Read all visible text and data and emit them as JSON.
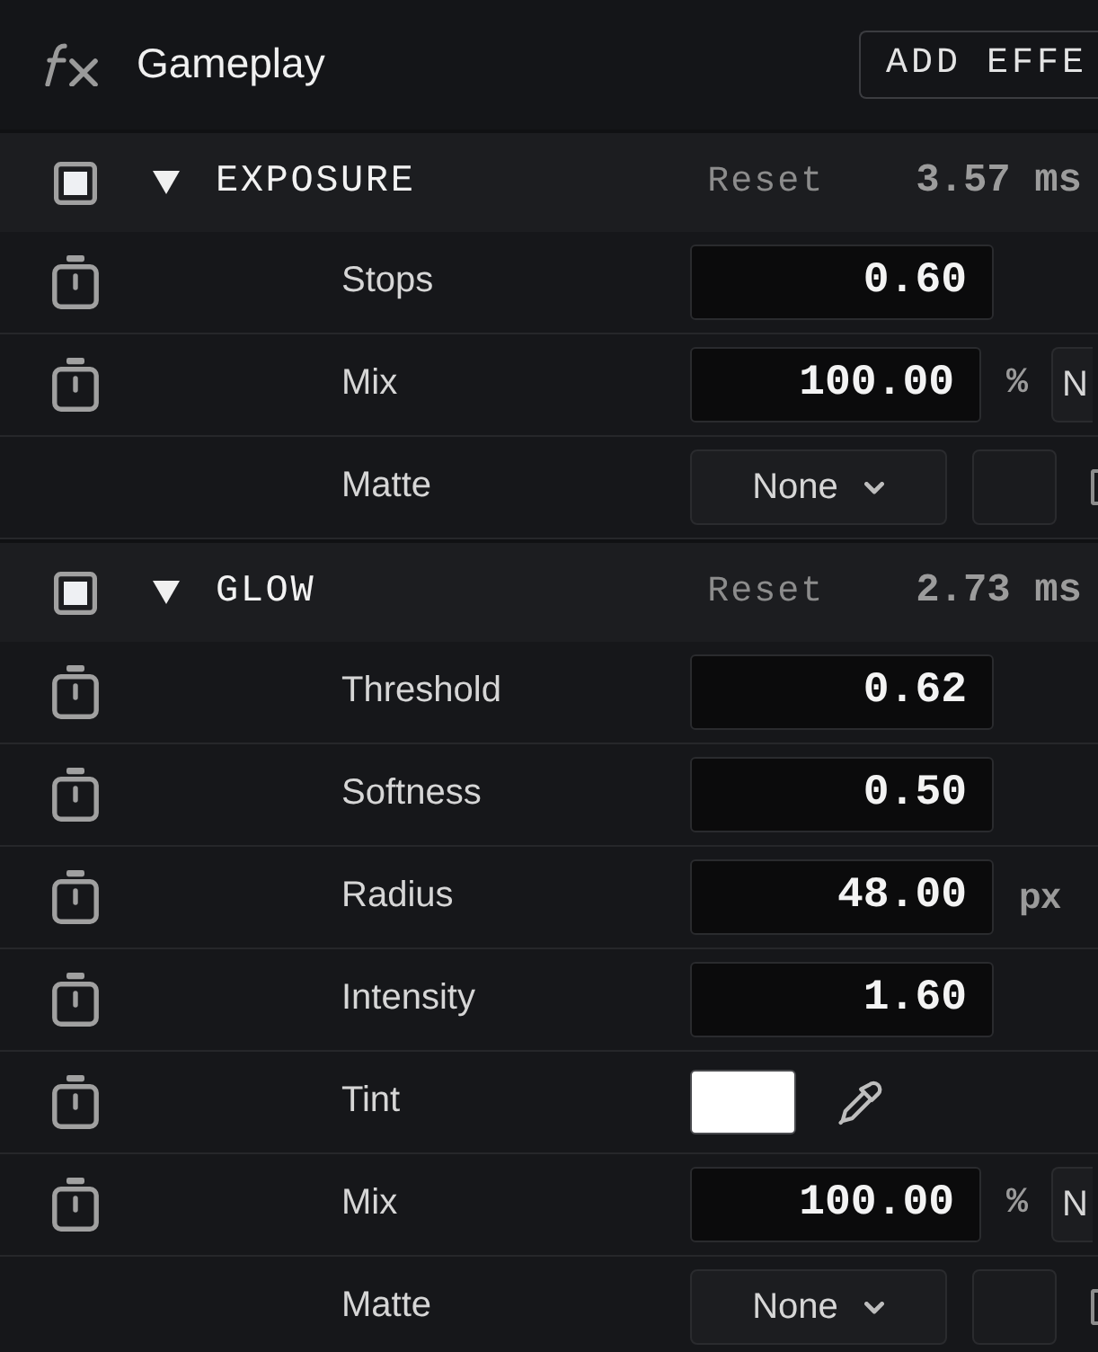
{
  "header": {
    "title": "Gameplay",
    "add_button": "ADD EFFE"
  },
  "effects": [
    {
      "name": "EXPOSURE",
      "enabled": true,
      "expanded": true,
      "reset": "Reset",
      "time": "3.57 ms",
      "params": [
        {
          "kind": "number",
          "label": "Stops",
          "animatable": true,
          "value": "0.60"
        },
        {
          "kind": "number",
          "label": "Mix",
          "animatable": true,
          "value": "100.00",
          "unit": "%",
          "mode": "N"
        },
        {
          "kind": "matte",
          "label": "Matte",
          "animatable": false,
          "value": "None",
          "checked": false
        }
      ]
    },
    {
      "name": "GLOW",
      "enabled": true,
      "expanded": true,
      "reset": "Reset",
      "time": "2.73 ms",
      "params": [
        {
          "kind": "number",
          "label": "Threshold",
          "animatable": true,
          "value": "0.62"
        },
        {
          "kind": "number",
          "label": "Softness",
          "animatable": true,
          "value": "0.50"
        },
        {
          "kind": "number",
          "label": "Radius",
          "animatable": true,
          "value": "48.00",
          "unit": "px"
        },
        {
          "kind": "number",
          "label": "Intensity",
          "animatable": true,
          "value": "1.60"
        },
        {
          "kind": "color",
          "label": "Tint",
          "animatable": true,
          "color": "#ffffff"
        },
        {
          "kind": "number",
          "label": "Mix",
          "animatable": true,
          "value": "100.00",
          "unit": "%",
          "mode": "N"
        },
        {
          "kind": "matte",
          "label": "Matte",
          "animatable": false,
          "value": "None",
          "checked": false
        }
      ]
    }
  ]
}
